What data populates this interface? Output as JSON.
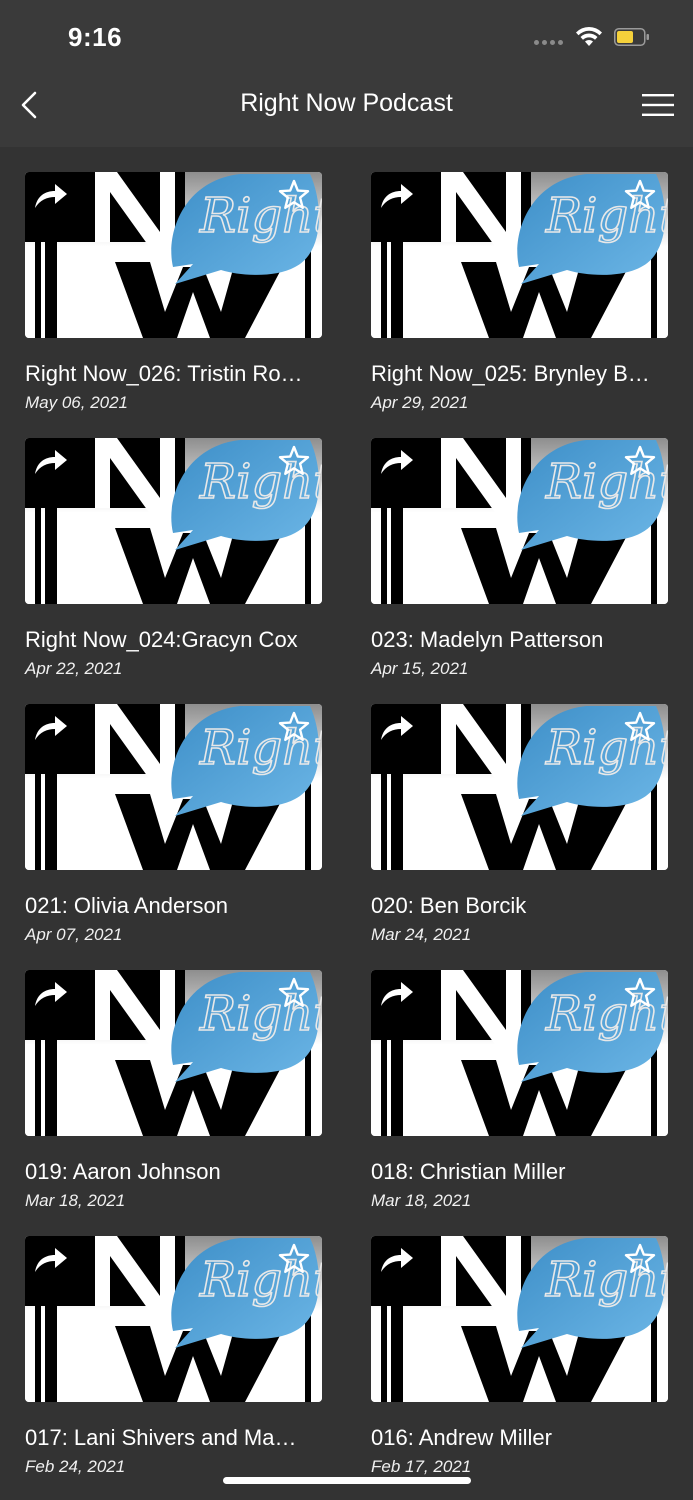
{
  "status": {
    "time": "9:16"
  },
  "nav": {
    "title": "Right Now Podcast"
  },
  "colors": {
    "background": "#333333",
    "bar": "#3a3a3a",
    "bubble": "#4aa0d8",
    "battery": "#f5d13b"
  },
  "thumbnail": {
    "logo_text": "Right"
  },
  "episodes": [
    {
      "title": "Right Now_026: Tristin Ro…",
      "date": "May 06, 2021"
    },
    {
      "title": "Right Now_025: Brynley B…",
      "date": "Apr 29, 2021"
    },
    {
      "title": "Right Now_024:Gracyn Cox",
      "date": "Apr 22, 2021"
    },
    {
      "title": "023: Madelyn Patterson",
      "date": "Apr 15, 2021"
    },
    {
      "title": "021: Olivia Anderson",
      "date": "Apr 07, 2021"
    },
    {
      "title": "020: Ben Borcik",
      "date": "Mar 24, 2021"
    },
    {
      "title": "019: Aaron Johnson",
      "date": "Mar 18, 2021"
    },
    {
      "title": "018: Christian Miller",
      "date": "Mar 18, 2021"
    },
    {
      "title": "017: Lani Shivers and Ma…",
      "date": "Feb 24, 2021"
    },
    {
      "title": "016: Andrew Miller",
      "date": "Feb 17, 2021"
    }
  ]
}
